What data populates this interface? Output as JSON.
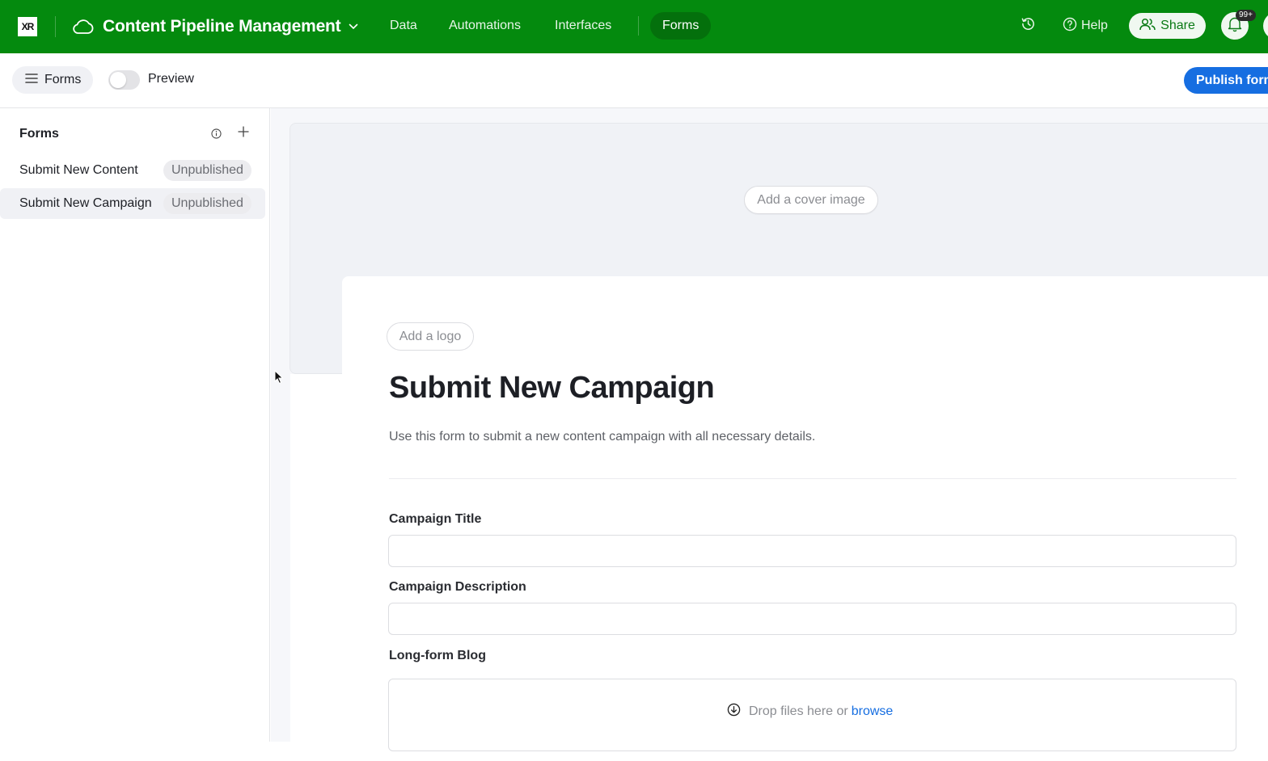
{
  "topbar": {
    "logo_text": "XR",
    "base_name": "Content Pipeline Management",
    "nav": [
      {
        "label": "Data",
        "active": false
      },
      {
        "label": "Automations",
        "active": false
      },
      {
        "label": "Interfaces",
        "active": false
      },
      {
        "label": "Forms",
        "active": true
      }
    ],
    "help_label": "Help",
    "share_label": "Share",
    "notifications_badge": "99+",
    "brand_color": "#048a0e"
  },
  "subbar": {
    "forms_toggle_label": "Forms",
    "preview_label": "Preview",
    "preview_enabled": false,
    "publish_label": "Publish form"
  },
  "sidebar": {
    "title": "Forms",
    "items": [
      {
        "label": "Submit New Content",
        "status": "Unpublished",
        "selected": false
      },
      {
        "label": "Submit New Campaign",
        "status": "Unpublished",
        "selected": true
      }
    ]
  },
  "form": {
    "cover_button": "Add a cover image",
    "logo_button": "Add a logo",
    "title": "Submit New Campaign",
    "description": "Use this form to submit a new content campaign with all necessary details.",
    "fields": [
      {
        "label": "Campaign Title",
        "value": "",
        "type": "text"
      },
      {
        "label": "Campaign Description",
        "value": "",
        "type": "text"
      },
      {
        "label": "Long-form Blog",
        "type": "attachment"
      }
    ],
    "dropzone_text": "Drop files here or",
    "dropzone_link": "browse",
    "accent_color": "#166ee1"
  }
}
